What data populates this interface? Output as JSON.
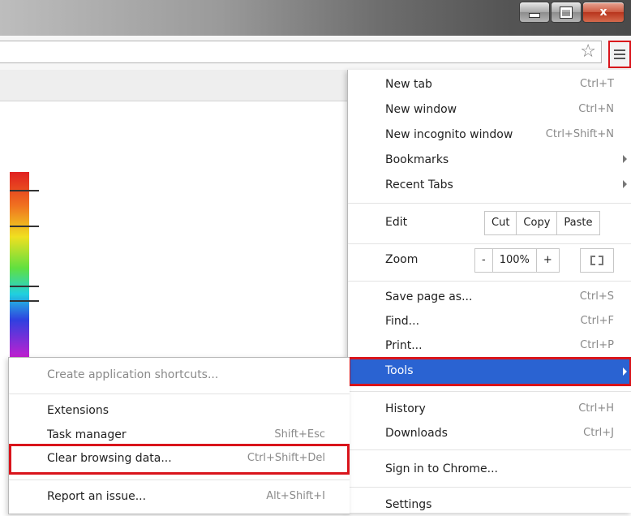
{
  "window": {
    "minimize_icon": "minimize-icon",
    "maximize_icon": "maximize-icon",
    "close_label": "x"
  },
  "toolbar": {
    "star_icon": "star-icon",
    "menu_icon": "hamburger-menu-icon"
  },
  "menu": {
    "new_tab": {
      "label": "New tab",
      "shortcut": "Ctrl+T"
    },
    "new_window": {
      "label": "New window",
      "shortcut": "Ctrl+N"
    },
    "new_incognito": {
      "label": "New incognito window",
      "shortcut": "Ctrl+Shift+N"
    },
    "bookmarks": {
      "label": "Bookmarks"
    },
    "recent_tabs": {
      "label": "Recent Tabs"
    },
    "edit": {
      "label": "Edit",
      "cut": "Cut",
      "copy": "Copy",
      "paste": "Paste"
    },
    "zoom": {
      "label": "Zoom",
      "minus": "-",
      "value": "100%",
      "plus": "+"
    },
    "save_page": {
      "label": "Save page as...",
      "shortcut": "Ctrl+S"
    },
    "find": {
      "label": "Find...",
      "shortcut": "Ctrl+F"
    },
    "print": {
      "label": "Print...",
      "shortcut": "Ctrl+P"
    },
    "tools": {
      "label": "Tools"
    },
    "history": {
      "label": "History",
      "shortcut": "Ctrl+H"
    },
    "downloads": {
      "label": "Downloads",
      "shortcut": "Ctrl+J"
    },
    "sign_in": {
      "label": "Sign in to Chrome..."
    },
    "settings": {
      "label": "Settings"
    }
  },
  "submenu": {
    "create_shortcuts": {
      "label": "Create application shortcuts..."
    },
    "extensions": {
      "label": "Extensions"
    },
    "task_manager": {
      "label": "Task manager",
      "shortcut": "Shift+Esc"
    },
    "clear_browsing": {
      "label": "Clear browsing data...",
      "shortcut": "Ctrl+Shift+Del"
    },
    "report_issue": {
      "label": "Report an issue...",
      "shortcut": "Alt+Shift+I"
    }
  },
  "colors": {
    "highlight": "#2a63d2",
    "annotation_red": "#d9141b"
  }
}
